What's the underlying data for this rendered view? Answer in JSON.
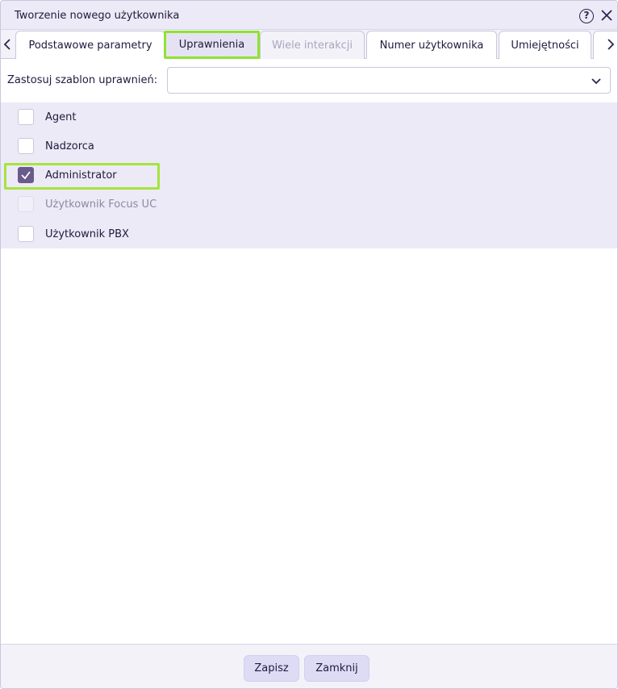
{
  "window": {
    "title": "Tworzenie nowego użytkownika",
    "help_glyph": "?"
  },
  "tabs": [
    {
      "label": "Podstawowe parametry",
      "state": "normal"
    },
    {
      "label": "Uprawnienia",
      "state": "active"
    },
    {
      "label": "Wiele interakcji",
      "state": "disabled"
    },
    {
      "label": "Numer użytkownika",
      "state": "normal"
    },
    {
      "label": "Umiejętności",
      "state": "normal"
    }
  ],
  "template": {
    "label": "Zastosuj szablon uprawnień:",
    "value": ""
  },
  "permissions": [
    {
      "label": "Agent",
      "checked": false,
      "disabled": false
    },
    {
      "label": "Nadzorca",
      "checked": false,
      "disabled": false
    },
    {
      "label": "Administrator",
      "checked": true,
      "disabled": false
    },
    {
      "label": "Użytkownik Focus UC",
      "checked": false,
      "disabled": true
    },
    {
      "label": "Użytkownik PBX",
      "checked": false,
      "disabled": false
    }
  ],
  "footer": {
    "save_label": "Zapisz",
    "close_label": "Zamknij"
  },
  "colors": {
    "highlight": "#a7e33f",
    "checkbox_checked": "#6b5a8c",
    "list_background": "#eceaf6"
  },
  "icons": {
    "help": "help-circle-icon",
    "close": "close-icon",
    "tab_prev": "chevron-left-icon",
    "tab_next": "chevron-right-icon",
    "dropdown": "chevron-down-icon",
    "check": "checkmark-icon"
  }
}
